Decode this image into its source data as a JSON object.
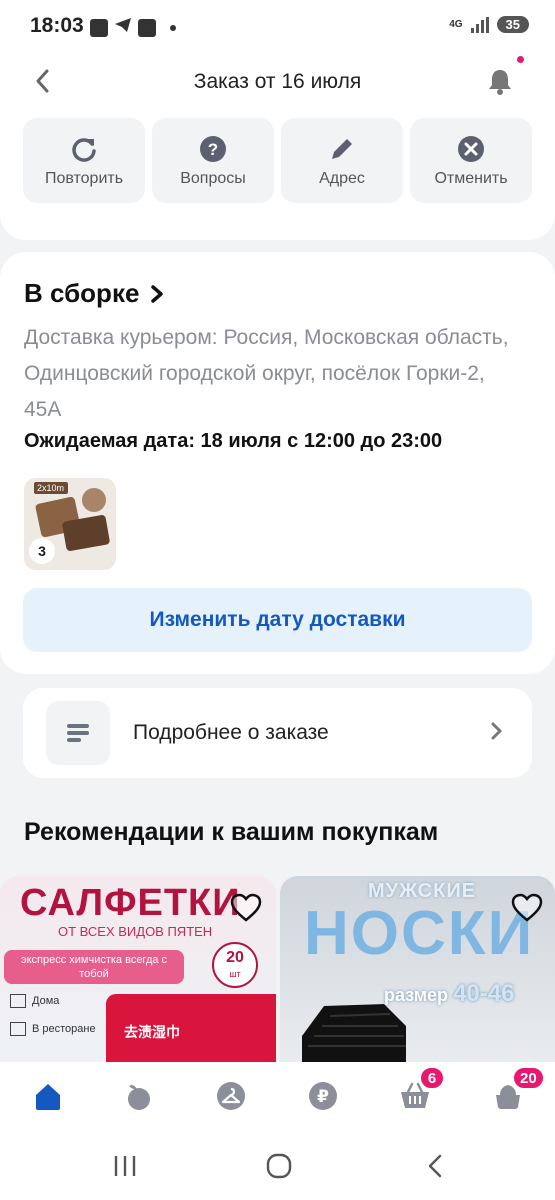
{
  "status_bar": {
    "time": "18:03",
    "network": "4G",
    "battery": "35"
  },
  "header": {
    "title": "Заказ от 16 июля",
    "back_icon": "chevron-left-icon",
    "bell_icon": "bell-icon"
  },
  "actions": [
    {
      "label": "Повторить",
      "icon": "repeat-icon"
    },
    {
      "label": "Вопросы",
      "icon": "question-icon"
    },
    {
      "label": "Адрес",
      "icon": "pencil-icon"
    },
    {
      "label": "Отменить",
      "icon": "cancel-icon"
    }
  ],
  "order": {
    "status": "В сборке",
    "delivery": "Доставка курьером: Россия, Московская область, Одинцовский городской округ, посёлок Горки-2, 45А",
    "expected_date": "Ожидаемая дата: 18 июля с 12:00 до 23:00",
    "item_thumb_label": "2x10m",
    "item_qty": "3",
    "change_date_button": "Изменить дату доставки"
  },
  "details": {
    "label": "Подробнее о заказе"
  },
  "recommendations": {
    "title": "Рекомендации к вашим покупкам",
    "items": [
      {
        "headline": "САЛФЕТКИ",
        "subline": "ОТ ВСЕХ ВИДОВ ПЯТЕН",
        "pill": "экспресс химчистка всегда с тобой",
        "count": "20",
        "count_unit": "шт",
        "line1": "Дома",
        "line2": "В ресторане",
        "pack_text": "去渍湿巾"
      },
      {
        "top": "МУЖСКИЕ",
        "headline": "НОСКИ",
        "size_label": "размер",
        "size_value": "40-46"
      }
    ]
  },
  "tabbar": {
    "items": [
      {
        "name": "home",
        "icon": "home-icon"
      },
      {
        "name": "catalog",
        "icon": "apple-icon"
      },
      {
        "name": "profile",
        "icon": "hanger-icon"
      },
      {
        "name": "payments",
        "icon": "ruble-icon"
      },
      {
        "name": "cart",
        "icon": "basket-icon",
        "badge": "6"
      },
      {
        "name": "orders",
        "icon": "pot-icon",
        "badge": "20"
      }
    ]
  },
  "colors": {
    "accent": "#1558c0",
    "badge": "#e9186f",
    "button_bg": "#e5f2fc",
    "muted": "#8a8d93"
  }
}
